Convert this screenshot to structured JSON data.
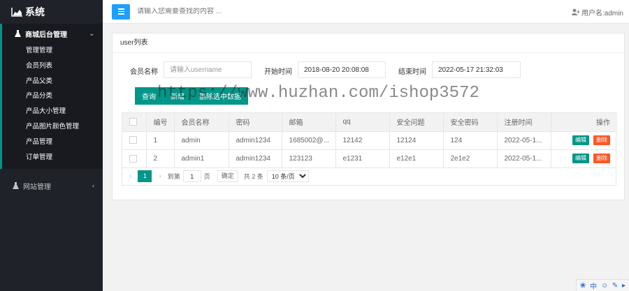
{
  "sidebar": {
    "logo": "系统",
    "groups": [
      {
        "label": "商城后台管理",
        "items": [
          "管理管理",
          "会员列表",
          "产品父类",
          "产品分类",
          "产品大小管理",
          "产品图片颜色管理",
          "产品管理",
          "订单管理"
        ]
      },
      {
        "label": "网站管理"
      }
    ]
  },
  "header": {
    "search_placeholder": "请输入您需要查找的内容 ...",
    "user": "用户名:admin"
  },
  "panel": {
    "title": "user列表",
    "filters": {
      "member_label": "会员名称",
      "member_placeholder": "请输入username",
      "start_label": "开始时间",
      "start_value": "2018-08-20 20:08:08",
      "end_label": "结束时间",
      "end_value": "2022-05-17 21:32:03"
    },
    "buttons": {
      "query": "查询",
      "add": "新增",
      "delete_selected": "删除选中数据"
    },
    "watermark": "https://www.huzhan.com/ishop3572",
    "table": {
      "columns": [
        "编号",
        "会员名称",
        "密码",
        "邮箱",
        "qq",
        "安全问题",
        "安全密码",
        "注册时间",
        "操作"
      ],
      "rows": [
        [
          "1",
          "admin",
          "admin1234",
          "1685002@...",
          "12142",
          "12124",
          "124",
          "2022-05-1..."
        ],
        [
          "2",
          "admin1",
          "admin1234",
          "123123",
          "e1231",
          "e12e1",
          "2e1e2",
          "2022-05-1..."
        ]
      ],
      "edit_label": "编辑",
      "delete_label": "删除"
    },
    "pager": {
      "prev": "‹",
      "current": "1",
      "next": "›",
      "goto_label": "到第",
      "goto_value": "1",
      "page_unit": "页",
      "confirm": "确定",
      "total": "共 2 条",
      "page_size": "10 条/页"
    }
  },
  "corner": {
    "lang": "中"
  }
}
